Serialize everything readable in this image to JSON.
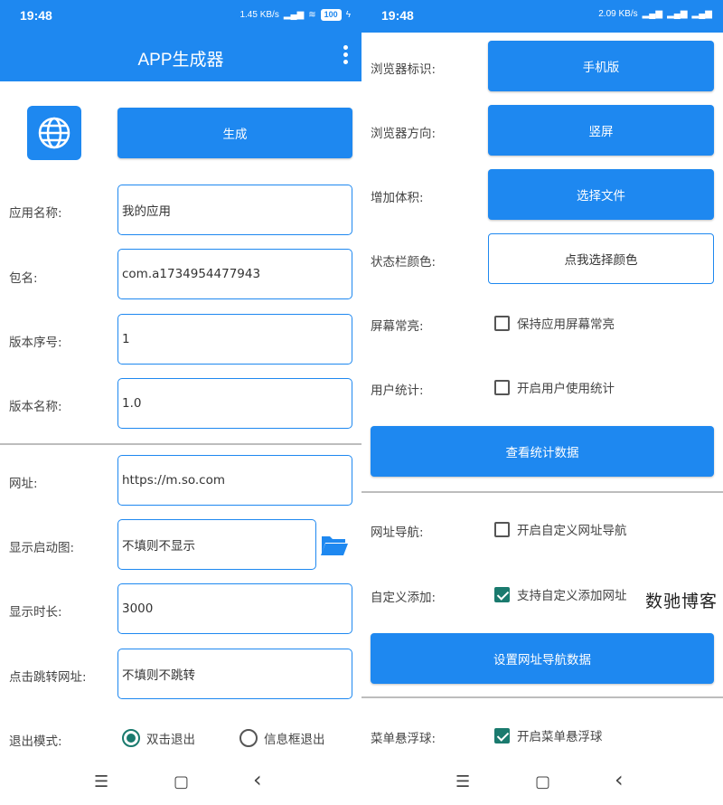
{
  "left": {
    "status": {
      "time": "19:48",
      "net": "1.45 KB/s",
      "battery": "100"
    },
    "appbar": {
      "title": "APP生成器"
    },
    "generate_label": "生成",
    "fields": {
      "app_name": {
        "label": "应用名称:",
        "value": "我的应用"
      },
      "package": {
        "label": "包名:",
        "value": "com.a1734954477943"
      },
      "version_code": {
        "label": "版本序号:",
        "value": "1"
      },
      "version_name": {
        "label": "版本名称:",
        "value": "1.0"
      },
      "url": {
        "label": "网址:",
        "value": "https://m.so.com"
      },
      "splash": {
        "label": "显示启动图:",
        "value": "不填则不显示"
      },
      "duration": {
        "label": "显示时长:",
        "value": "3000"
      },
      "click_url": {
        "label": "点击跳转网址:",
        "value": "不填则不跳转"
      }
    },
    "exit_mode": {
      "label": "退出模式:",
      "option1": "双击退出",
      "option2": "信息框退出"
    }
  },
  "right": {
    "status": {
      "time": "19:48",
      "net": "2.09 KB/s"
    },
    "ua": {
      "label": "浏览器标识:",
      "button": "手机版"
    },
    "orientation": {
      "label": "浏览器方向:",
      "button": "竖屏"
    },
    "size": {
      "label": "增加体积:",
      "button": "选择文件"
    },
    "statusbar_color": {
      "label": "状态栏颜色:",
      "button": "点我选择颜色"
    },
    "keep_screen": {
      "label": "屏幕常亮:",
      "checkbox": "保持应用屏幕常亮"
    },
    "stats": {
      "label": "用户统计:",
      "checkbox": "开启用户使用统计"
    },
    "view_stats": "查看统计数据",
    "url_nav": {
      "label": "网址导航:",
      "checkbox": "开启自定义网址导航"
    },
    "custom_add": {
      "label": "自定义添加:",
      "checkbox": "支持自定义添加网址"
    },
    "nav_data": "设置网址导航数据",
    "float_ball": {
      "label": "菜单悬浮球:",
      "checkbox": "开启菜单悬浮球"
    }
  },
  "nav": {
    "menu": "☰",
    "home": "▢",
    "back": "‹"
  },
  "watermark": "数驰博客",
  "colors": {
    "accent": "#1E88F0",
    "checked": "#1a7a6e"
  },
  "state": {
    "exit_mode_selected": "双击退出",
    "keep_screen_checked": false,
    "stats_checked": false,
    "url_nav_checked": false,
    "custom_add_checked": true,
    "float_ball_checked": true
  }
}
